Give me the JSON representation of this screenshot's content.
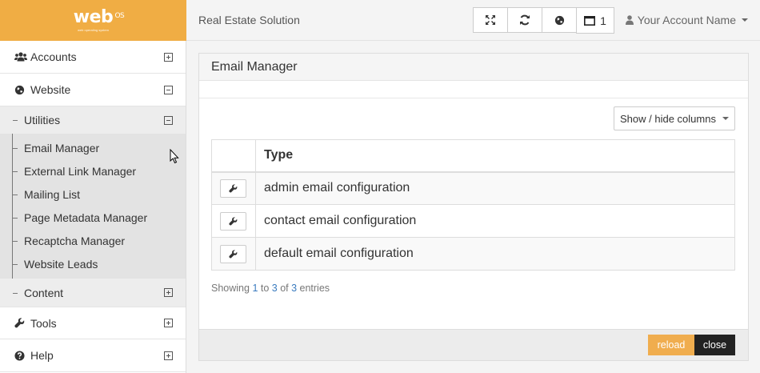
{
  "logo": {
    "text": "web",
    "sup": "OS",
    "tagline": "web operating system"
  },
  "app_title": "Real Estate Solution",
  "toolbar": {
    "window_count": "1"
  },
  "account": {
    "label": "Your Account Name"
  },
  "sidebar": {
    "items": [
      {
        "label": "Accounts",
        "icon": "users-icon",
        "state": "collapsed"
      },
      {
        "label": "Website",
        "icon": "globe-icon",
        "state": "expanded"
      }
    ],
    "website_children": {
      "utilities": {
        "label": "Utilities",
        "state": "expanded"
      },
      "utility_items": [
        "Email Manager",
        "External Link Manager",
        "Mailing List",
        "Page Metadata Manager",
        "Recaptcha Manager",
        "Website Leads"
      ],
      "content": {
        "label": "Content",
        "state": "collapsed"
      }
    },
    "bottom_items": [
      {
        "label": "Tools",
        "icon": "wrench-icon",
        "state": "collapsed"
      },
      {
        "label": "Help",
        "icon": "question-icon",
        "state": "collapsed"
      }
    ]
  },
  "panel": {
    "title": "Email Manager",
    "columns_button": "Show / hide columns",
    "table": {
      "headers": [
        "",
        "Type"
      ],
      "rows": [
        "admin email configuration",
        "contact email configuration",
        "default email configuration"
      ]
    },
    "info": {
      "prefix": "Showing ",
      "from": "1",
      "to_word": " to ",
      "to": "3",
      "of_word": " of ",
      "total": "3",
      "suffix": " entries"
    },
    "footer": {
      "reload": "reload",
      "close": "close"
    }
  },
  "colors": {
    "brand": "#f0ad44",
    "reload": "#f0ad4e",
    "close": "#222222",
    "link": "#3a7bbf"
  }
}
